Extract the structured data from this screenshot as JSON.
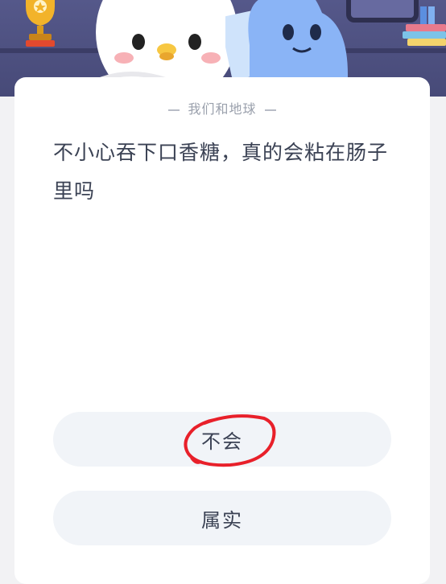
{
  "card": {
    "category": "我们和地球",
    "question": "不小心吞下口香糖，真的会粘在肠子里吗"
  },
  "options": [
    {
      "label": "不会",
      "circled": true
    },
    {
      "label": "属实",
      "circled": false
    }
  ],
  "colors": {
    "header_bg": "#4a4c7a",
    "option_bg": "#f1f4f8",
    "mark_red": "#e8202a",
    "text": "#3b4254"
  },
  "icons": [
    "trophy-icon",
    "books-icon",
    "ghost-mascot",
    "blue-mascot"
  ]
}
